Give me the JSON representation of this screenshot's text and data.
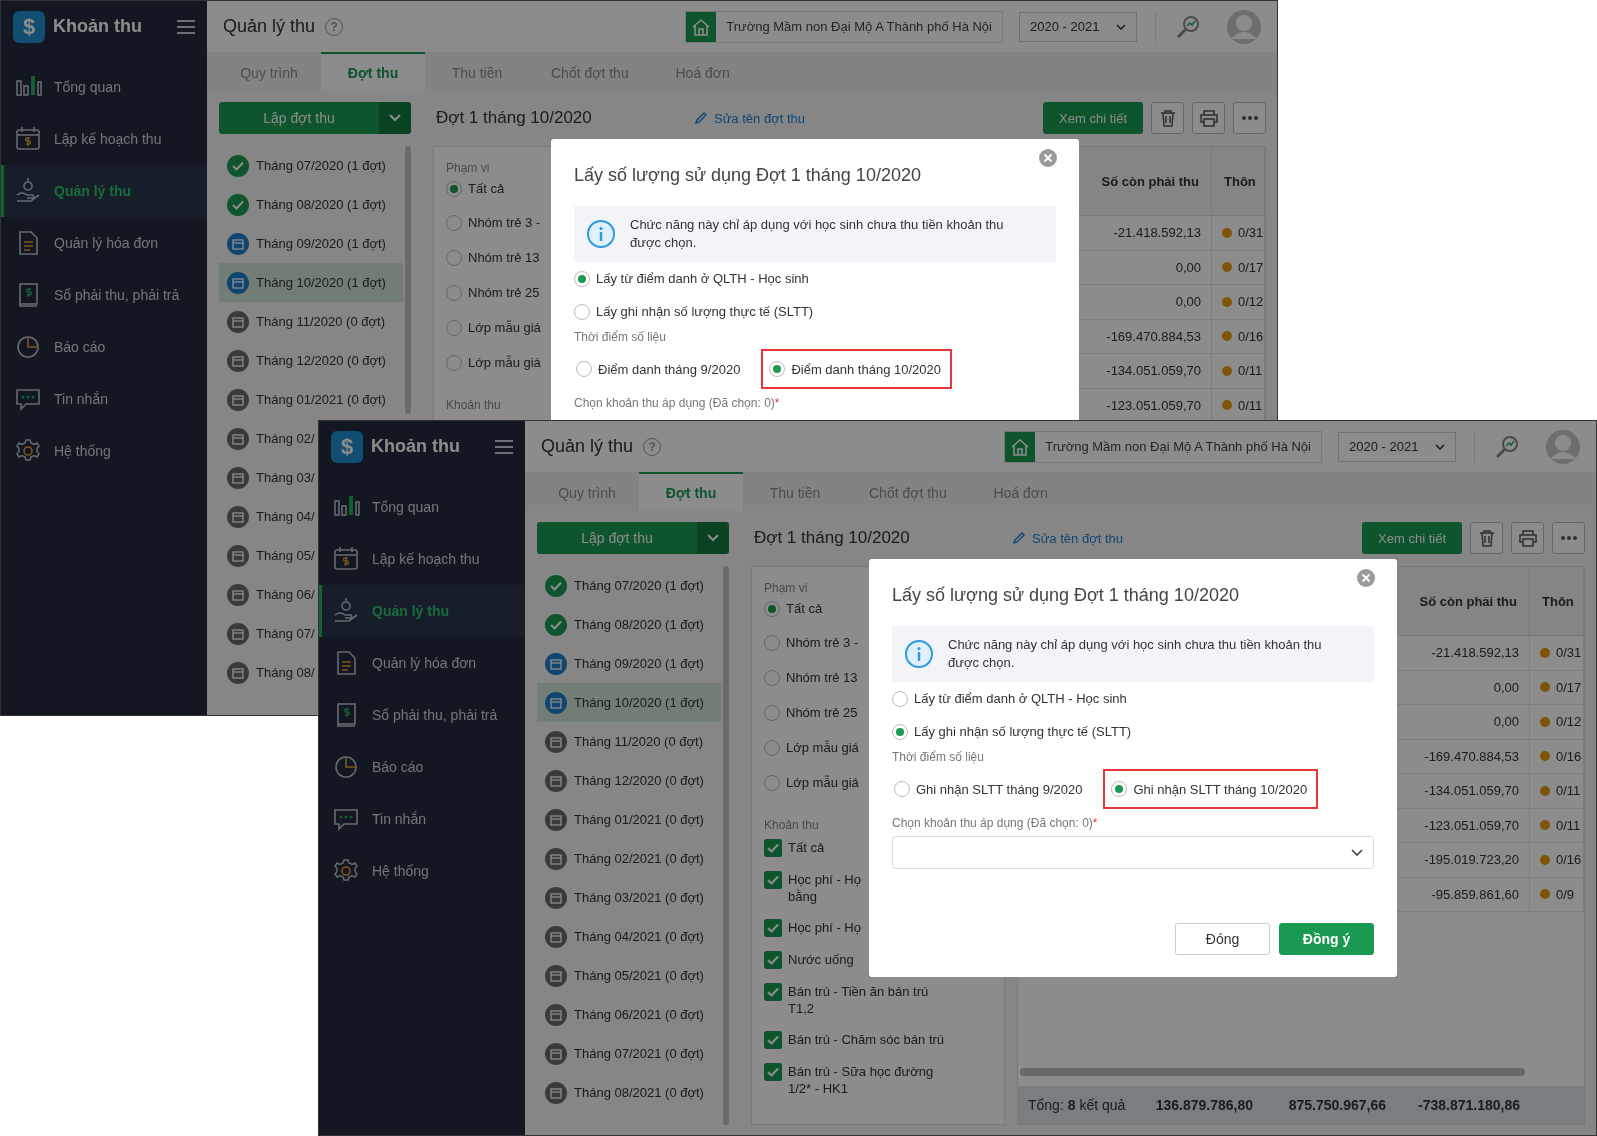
{
  "windows": [
    {
      "logo_mark": "$",
      "app_title": "Khoản thu",
      "nav": [
        {
          "label": "Tổng quan",
          "selected": false
        },
        {
          "label": "Lập kế hoạch thu",
          "selected": false
        },
        {
          "label": "Quản lý thu",
          "selected": true
        },
        {
          "label": "Quản lý hóa đơn",
          "selected": false
        },
        {
          "label": "Sổ phải thu, phải trả",
          "selected": false
        },
        {
          "label": "Báo cáo",
          "selected": false
        },
        {
          "label": "Tin nhắn",
          "selected": false
        },
        {
          "label": "Hệ thống",
          "selected": false
        }
      ],
      "page_title": "Quản lý thu",
      "help_mark": "?",
      "school": "Trường Mầm non Đại Mộ A Thành phố Hà Nội",
      "year": "2020 - 2021",
      "tabs": [
        {
          "label": "Quy trình",
          "selected": false
        },
        {
          "label": "Đợt thu",
          "selected": true
        },
        {
          "label": "Thu tiền",
          "selected": false
        },
        {
          "label": "Chốt đợt thu",
          "selected": false
        },
        {
          "label": "Hoá đơn",
          "selected": false
        }
      ],
      "create_button": "Lập đợt thu",
      "months": [
        {
          "label": "Tháng 07/2020 (1 đợt)",
          "kind": "done",
          "selected": false
        },
        {
          "label": "Tháng 08/2020 (1 đợt)",
          "kind": "done",
          "selected": false
        },
        {
          "label": "Tháng 09/2020 (1 đợt)",
          "kind": "current",
          "selected": false
        },
        {
          "label": "Tháng 10/2020 (1 đợt)",
          "kind": "current",
          "selected": true
        },
        {
          "label": "Tháng 11/2020 (0 đợt)",
          "kind": "empty",
          "selected": false
        },
        {
          "label": "Tháng 12/2020 (0 đợt)",
          "kind": "empty",
          "selected": false
        },
        {
          "label": "Tháng 01/2021 (0 đợt)",
          "kind": "empty",
          "selected": false
        },
        {
          "label": "Tháng 02/",
          "kind": "empty",
          "selected": false
        },
        {
          "label": "Tháng 03/",
          "kind": "empty",
          "selected": false
        },
        {
          "label": "Tháng 04/",
          "kind": "empty",
          "selected": false
        },
        {
          "label": "Tháng 05/",
          "kind": "empty",
          "selected": false
        },
        {
          "label": "Tháng 06/",
          "kind": "empty",
          "selected": false
        },
        {
          "label": "Tháng 07/",
          "kind": "empty",
          "selected": false
        },
        {
          "label": "Tháng 08/",
          "kind": "empty",
          "selected": false
        }
      ],
      "batch_title": "Đợt 1 tháng 10/2020",
      "rename_link": "Sửa tên đợt thu",
      "detail_button": "Xem chi tiết",
      "filter": {
        "scope_label": "Phạm vi",
        "scope_options": [
          {
            "label": "Tất cả",
            "selected": true
          },
          {
            "label": "Nhóm trẻ 3 -",
            "selected": false
          },
          {
            "label": "Nhóm trẻ 13",
            "selected": false
          },
          {
            "label": "Nhóm trẻ 25",
            "selected": false
          },
          {
            "label": "Lớp mẫu giá",
            "selected": false
          },
          {
            "label": "Lớp mẫu giá",
            "selected": false
          }
        ],
        "fees_label": "Khoản thu"
      },
      "table": {
        "columns": [
          "Số còn phải thu",
          "Thôn"
        ],
        "rows": [
          {
            "remaining": "-21.418.592,13",
            "info": "0/31"
          },
          {
            "remaining": "0,00",
            "info": "0/17"
          },
          {
            "remaining": "0,00",
            "info": "0/12"
          },
          {
            "remaining": "-169.470.884,53",
            "info": "0/16"
          },
          {
            "remaining": "-134.051.059,70",
            "info": "0/11"
          },
          {
            "remaining": "-123.051.059,70",
            "info": "0/11"
          }
        ]
      },
      "dialog": {
        "title": "Lấy số lượng sử dụng Đợt 1 tháng 10/2020",
        "info": "Chức năng này chỉ áp dụng với học sinh chưa thu tiền khoản thu được chọn.",
        "sources": [
          {
            "label": "Lấy từ điểm danh ở QLTH - Học sinh",
            "selected": true
          },
          {
            "label": "Lấy ghi nhận số lượng thực tế (SLTT)",
            "selected": false
          }
        ],
        "period_label": "Thời điểm số liệu",
        "periods": [
          {
            "label": "Điểm danh tháng 9/2020",
            "selected": false,
            "highlighted": false
          },
          {
            "label": "Điểm danh tháng 10/2020",
            "selected": true,
            "highlighted": true
          }
        ],
        "fee_select_label": "Chọn khoản thu áp dụng (Đã chọn: 0)",
        "required_mark": "*"
      }
    },
    {
      "logo_mark": "$",
      "app_title": "Khoản thu",
      "nav": [
        {
          "label": "Tổng quan",
          "selected": false
        },
        {
          "label": "Lập kế hoạch thu",
          "selected": false
        },
        {
          "label": "Quản lý thu",
          "selected": true
        },
        {
          "label": "Quản lý hóa đơn",
          "selected": false
        },
        {
          "label": "Sổ phải thu, phải trả",
          "selected": false
        },
        {
          "label": "Báo cáo",
          "selected": false
        },
        {
          "label": "Tin nhắn",
          "selected": false
        },
        {
          "label": "Hệ thống",
          "selected": false
        }
      ],
      "page_title": "Quản lý thu",
      "help_mark": "?",
      "school": "Trường Mầm non Đại Mộ A Thành phố Hà Nội",
      "year": "2020 - 2021",
      "tabs": [
        {
          "label": "Quy trình",
          "selected": false
        },
        {
          "label": "Đợt thu",
          "selected": true
        },
        {
          "label": "Thu tiền",
          "selected": false
        },
        {
          "label": "Chốt đợt thu",
          "selected": false
        },
        {
          "label": "Hoá đơn",
          "selected": false
        }
      ],
      "create_button": "Lập đợt thu",
      "months": [
        {
          "label": "Tháng 07/2020 (1 đợt)",
          "kind": "done",
          "selected": false
        },
        {
          "label": "Tháng 08/2020 (1 đợt)",
          "kind": "done",
          "selected": false
        },
        {
          "label": "Tháng 09/2020 (1 đợt)",
          "kind": "current",
          "selected": false
        },
        {
          "label": "Tháng 10/2020 (1 đợt)",
          "kind": "current",
          "selected": true
        },
        {
          "label": "Tháng 11/2020 (0 đợt)",
          "kind": "empty",
          "selected": false
        },
        {
          "label": "Tháng 12/2020 (0 đợt)",
          "kind": "empty",
          "selected": false
        },
        {
          "label": "Tháng 01/2021 (0 đợt)",
          "kind": "empty",
          "selected": false
        },
        {
          "label": "Tháng 02/2021 (0 đợt)",
          "kind": "empty",
          "selected": false
        },
        {
          "label": "Tháng 03/2021 (0 đợt)",
          "kind": "empty",
          "selected": false
        },
        {
          "label": "Tháng 04/2021 (0 đợt)",
          "kind": "empty",
          "selected": false
        },
        {
          "label": "Tháng 05/2021 (0 đợt)",
          "kind": "empty",
          "selected": false
        },
        {
          "label": "Tháng 06/2021 (0 đợt)",
          "kind": "empty",
          "selected": false
        },
        {
          "label": "Tháng 07/2021 (0 đợt)",
          "kind": "empty",
          "selected": false
        },
        {
          "label": "Tháng 08/2021 (0 đợt)",
          "kind": "empty",
          "selected": false
        }
      ],
      "batch_title": "Đợt 1 tháng 10/2020",
      "rename_link": "Sửa tên đợt thu",
      "detail_button": "Xem chi tiết",
      "filter": {
        "scope_label": "Phạm vi",
        "scope_options": [
          {
            "label": "Tất cả",
            "selected": true
          },
          {
            "label": "Nhóm trẻ 3 -",
            "selected": false
          },
          {
            "label": "Nhóm trẻ 13",
            "selected": false
          },
          {
            "label": "Nhóm trẻ 25",
            "selected": false
          },
          {
            "label": "Lớp mẫu giá",
            "selected": false
          },
          {
            "label": "Lớp mẫu giá",
            "selected": false
          }
        ],
        "fees_label": "Khoản thu",
        "fees": [
          {
            "lines": [
              "Tất cả"
            ],
            "checked": true
          },
          {
            "lines": [
              "Học phí - Họ",
              "bằng"
            ],
            "checked": true
          },
          {
            "lines": [
              "Học phí - Họ"
            ],
            "checked": true
          },
          {
            "lines": [
              "Nước uống"
            ],
            "checked": true
          },
          {
            "lines": [
              "Bán trú - Tiền ăn bán trú",
              "T1,2"
            ],
            "checked": true
          },
          {
            "lines": [
              "Bán trú - Chăm sóc bán trú"
            ],
            "checked": true
          },
          {
            "lines": [
              "Bán trú - Sữa học đường",
              "1/2* - HK1"
            ],
            "checked": true
          }
        ]
      },
      "table": {
        "columns": [
          "Số còn phải thu",
          "Thôn"
        ],
        "rows": [
          {
            "remaining": "-21.418.592,13",
            "info": "0/31"
          },
          {
            "remaining": "0,00",
            "info": "0/17"
          },
          {
            "remaining": "0,00",
            "info": "0/12"
          },
          {
            "remaining": "-169.470.884,53",
            "info": "0/16"
          },
          {
            "remaining": "-134.051.059,70",
            "info": "0/11"
          },
          {
            "remaining": "-123.051.059,70",
            "info": "0/11"
          },
          {
            "remaining": "-195.019.723,20",
            "info": "0/16"
          },
          {
            "remaining": "-95.859.861,60",
            "info": "0/9"
          }
        ],
        "footer": {
          "label": "Tổng: **8** kết quả",
          "totals": [
            "136.879.786,80",
            "875.750.967,66",
            "-738.871.180,86"
          ]
        }
      },
      "dialog": {
        "title": "Lấy số lượng sử dụng Đợt 1 tháng 10/2020",
        "info": "Chức năng này chỉ áp dụng với học sinh chưa thu tiền khoản thu được chọn.",
        "sources": [
          {
            "label": "Lấy từ điểm danh ở QLTH - Học sinh",
            "selected": false
          },
          {
            "label": "Lấy ghi nhận số lượng thực tế (SLTT)",
            "selected": true
          }
        ],
        "period_label": "Thời điểm số liệu",
        "periods": [
          {
            "label": "Ghi nhận SLTT tháng 9/2020",
            "selected": false,
            "highlighted": false
          },
          {
            "label": "Ghi nhận SLTT tháng 10/2020",
            "selected": true,
            "highlighted": true
          }
        ],
        "fee_select_label": "Chọn khoản thu áp dụng (Đã chọn: 0)",
        "required_mark": "*",
        "buttons": [
          {
            "label": "Đóng",
            "kind": "secondary"
          },
          {
            "label": "Đồng ý",
            "kind": "primary"
          }
        ]
      }
    }
  ]
}
